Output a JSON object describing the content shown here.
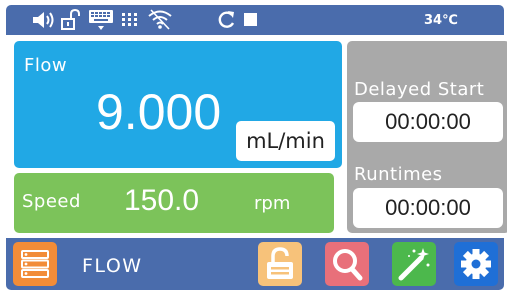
{
  "status_bar": {
    "temperature": "34℃",
    "icons": [
      "speaker-icon",
      "unlocked-icon",
      "keyboard-icon",
      "keypad-icon",
      "wifi-icon",
      "refresh-icon",
      "stop-icon"
    ]
  },
  "flow": {
    "label": "Flow",
    "value": "9.000",
    "unit": "mL/min"
  },
  "speed": {
    "label": "Speed",
    "value": "150.0",
    "unit": "rpm"
  },
  "delayed_start": {
    "label": "Delayed Start",
    "value": "00:00:00"
  },
  "runtimes": {
    "label": "Runtimes",
    "value": "00:00:00"
  },
  "nav": {
    "mode_title": "FLOW",
    "buttons": [
      "menu-list-icon",
      "unlock-icon",
      "search-icon",
      "calibrate-wand-icon",
      "settings-gear-icon"
    ]
  },
  "colors": {
    "bar_blue": "#4a6cac",
    "flow_panel": "#21a8e5",
    "speed_panel": "#7cc35a",
    "side_panel": "#a9a9a9",
    "menu_button": "#f28c38",
    "unlock_button": "#f7c27a",
    "search_button": "#e8707a",
    "wand_button": "#4cb84c",
    "settings_button": "#1f6fd6"
  }
}
